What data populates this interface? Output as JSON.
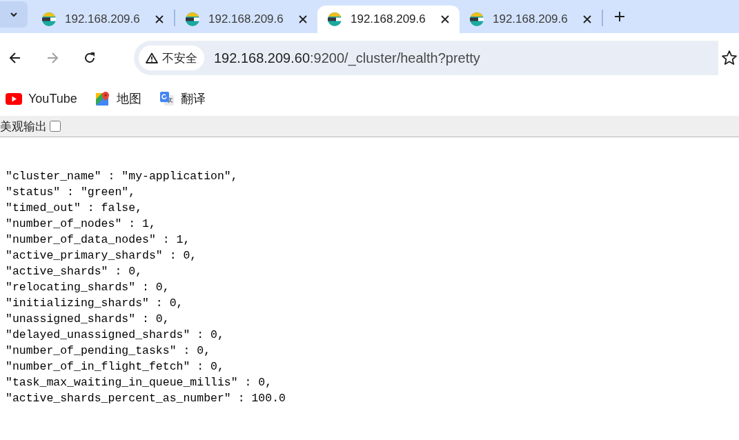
{
  "tabs": [
    {
      "title": "192.168.209.6",
      "selected": false
    },
    {
      "title": "192.168.209.6",
      "selected": false
    },
    {
      "title": "192.168.209.6",
      "selected": true
    },
    {
      "title": "192.168.209.6",
      "selected": false
    }
  ],
  "address": {
    "security": "不安全",
    "host": "192.168.209.60",
    "path": ":9200/_cluster/health?pretty"
  },
  "bookmarks": [
    {
      "kind": "youtube",
      "label": "YouTube"
    },
    {
      "kind": "maps",
      "label": "地图"
    },
    {
      "kind": "translate",
      "label": "翻译"
    }
  ],
  "pretty_toggle": {
    "label": "美观输出",
    "checked": false
  },
  "lines": [
    "\"cluster_name\" : \"my-application\",",
    "\"status\" : \"green\",",
    "\"timed_out\" : false,",
    "\"number_of_nodes\" : 1,",
    "\"number_of_data_nodes\" : 1,",
    "\"active_primary_shards\" : 0,",
    "\"active_shards\" : 0,",
    "\"relocating_shards\" : 0,",
    "\"initializing_shards\" : 0,",
    "\"unassigned_shards\" : 0,",
    "\"delayed_unassigned_shards\" : 0,",
    "\"number_of_pending_tasks\" : 0,",
    "\"number_of_in_flight_fetch\" : 0,",
    "\"task_max_waiting_in_queue_millis\" : 0,",
    "\"active_shards_percent_as_number\" : 100.0"
  ]
}
